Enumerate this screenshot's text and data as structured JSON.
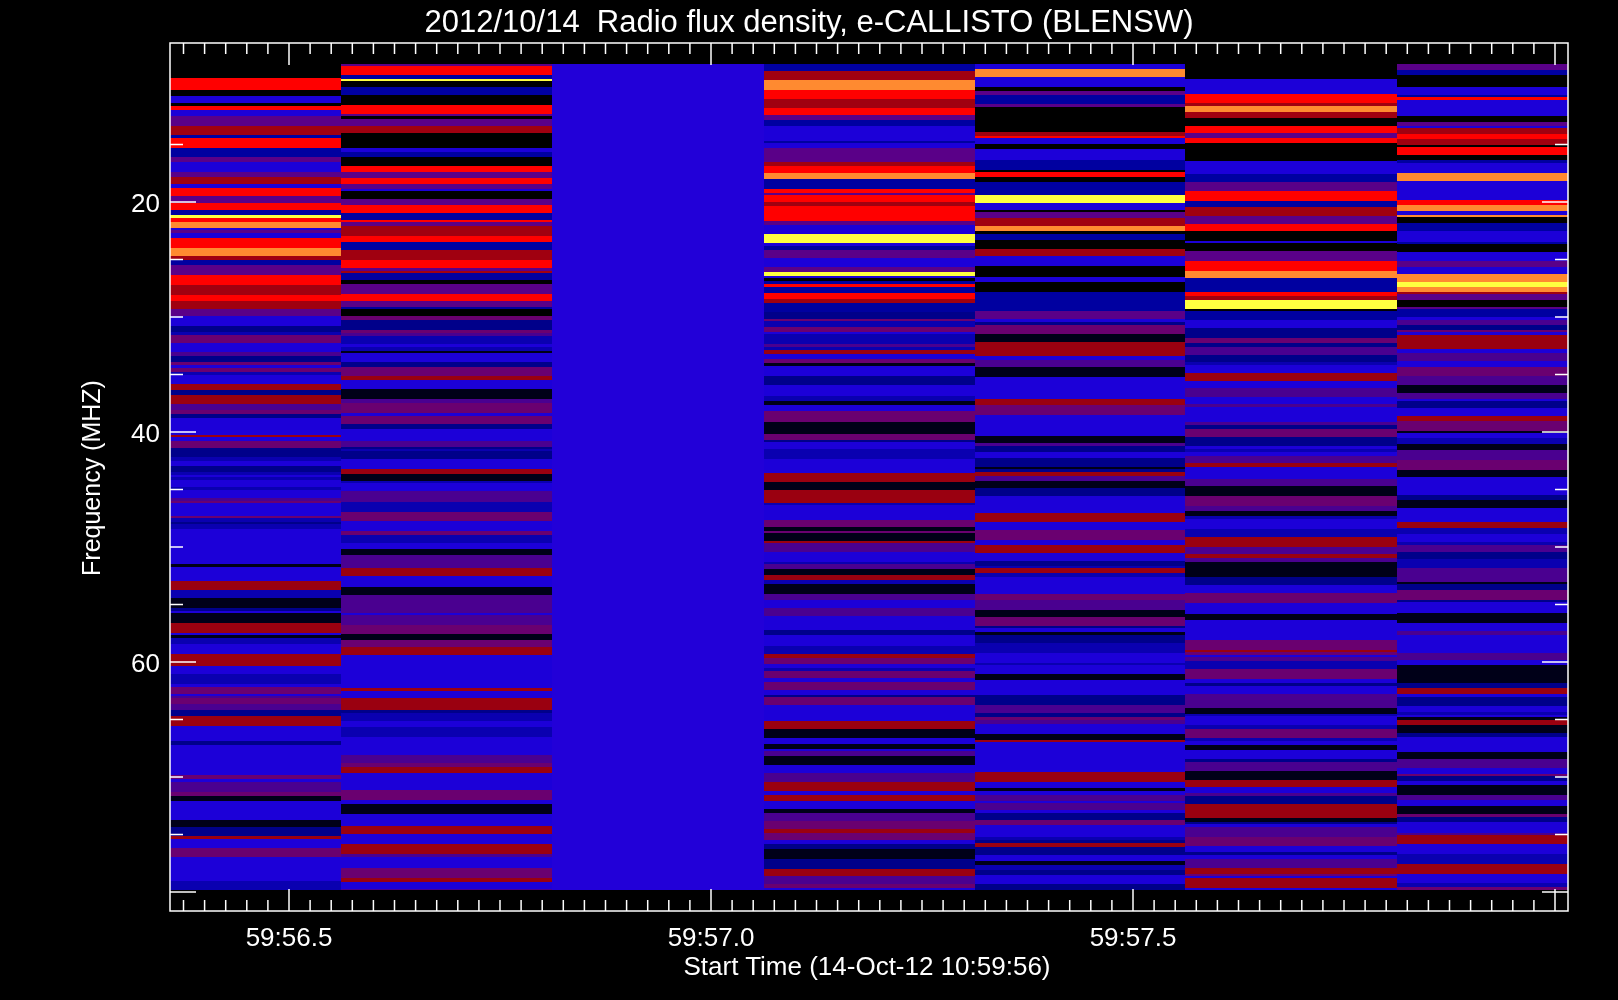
{
  "title": "2012/10/14  Radio flux density, e-CALLISTO (BLENSW)",
  "plot": {
    "ylabel": "Frequency (MHZ)",
    "xlabel": "Start Time (14-Oct-12 10:59:56)",
    "yticks": [
      "20",
      "40",
      "60"
    ],
    "xticks": [
      "59:56.5",
      "59:57.0",
      "59:57.5"
    ]
  }
}
